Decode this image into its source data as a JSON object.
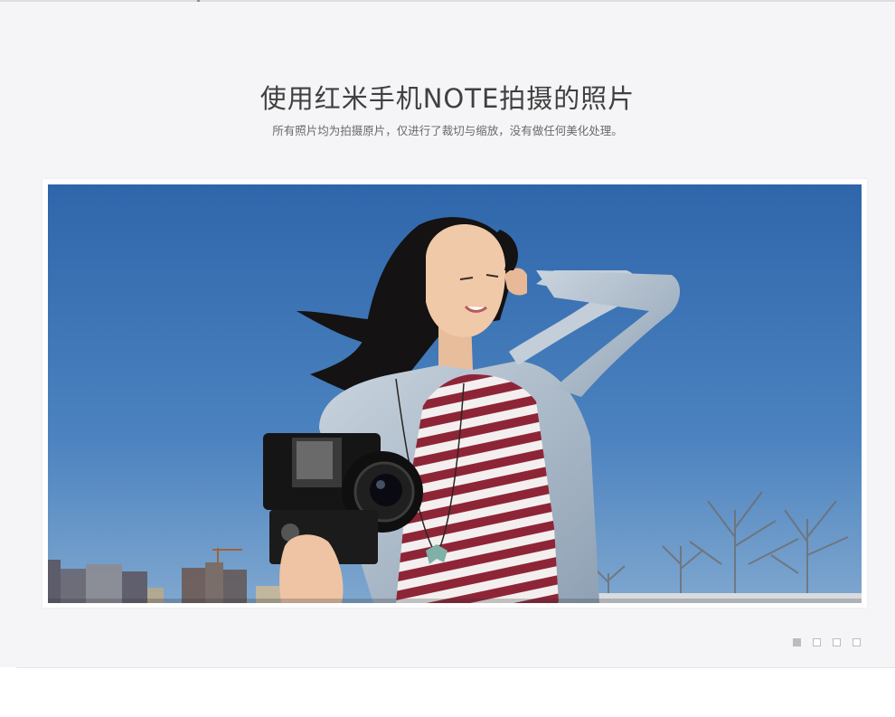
{
  "showcase": {
    "title": "使用红米手机NOTE拍摄的照片",
    "subtitle": "所有照片均为拍摄原片，仅进行了裁切与缩放，没有做任何美化处理。"
  },
  "carousel": {
    "slide_count": 4,
    "active_index": 0,
    "slide_photo": "woman-with-camera-photo"
  },
  "colors": {
    "section_bg": "#f5f5f7",
    "title": "#404040",
    "subtitle": "#6a6a6a",
    "sky": "#3f74b2",
    "pager_active": "#bcbcbc"
  }
}
